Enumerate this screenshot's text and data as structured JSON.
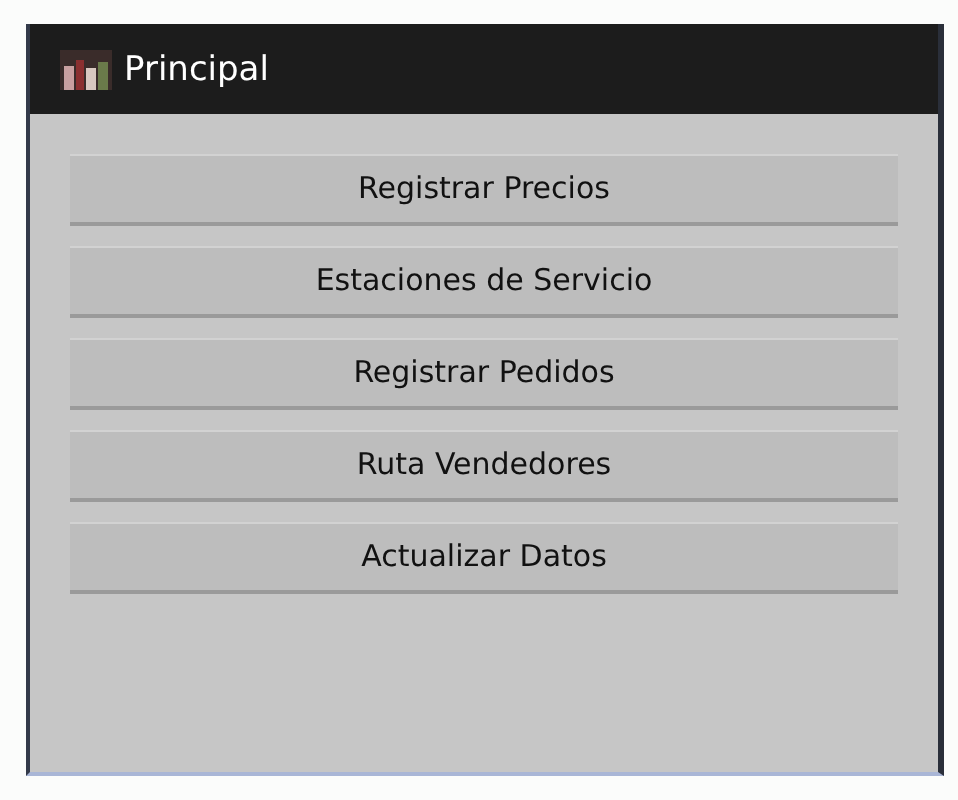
{
  "window": {
    "title": "Principal"
  },
  "buttons": [
    "Registrar Precios",
    "Estaciones de Servicio",
    "Registrar Pedidos",
    "Ruta Vendedores",
    "Actualizar Datos"
  ]
}
